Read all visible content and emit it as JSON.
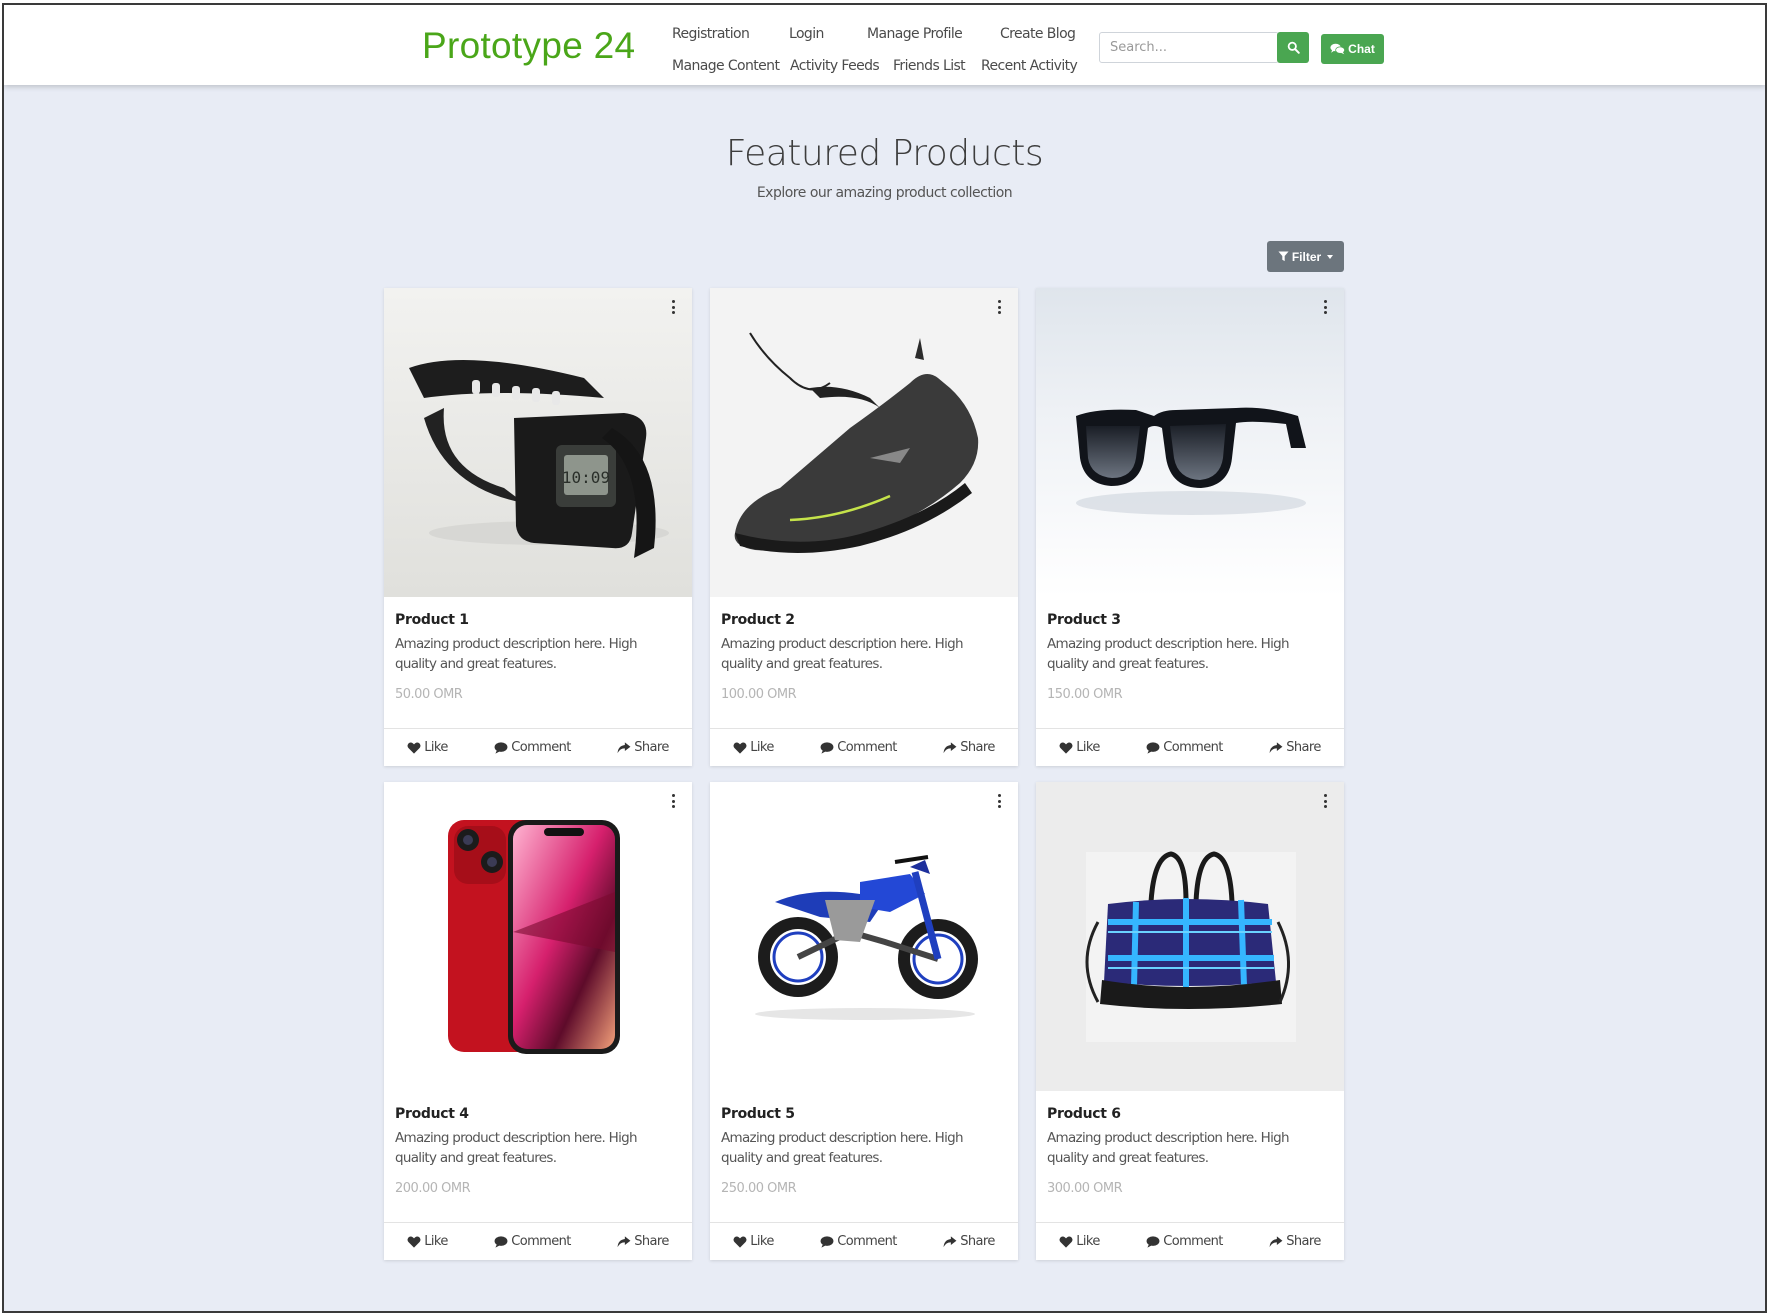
{
  "brand": "Prototype 24",
  "nav": {
    "row1": [
      "Registration",
      "Login",
      "Manage Profile",
      "Create Blog"
    ],
    "row2": [
      "Manage Content",
      "Activity Feeds",
      "Friends List",
      "Recent Activity"
    ]
  },
  "search": {
    "placeholder": "Search..."
  },
  "chat_label": "Chat",
  "heading": {
    "title": "Featured Products",
    "subtitle": "Explore our amazing product collection"
  },
  "filter_label": "Filter",
  "actions": {
    "like": "Like",
    "comment": "Comment",
    "share": "Share"
  },
  "products": [
    {
      "title": "Product 1",
      "description": "Amazing product description here. High quality and great features.",
      "price": "50.00 OMR",
      "image": "watch"
    },
    {
      "title": "Product 2",
      "description": "Amazing product description here. High quality and great features.",
      "price": "100.00 OMR",
      "image": "sneaker"
    },
    {
      "title": "Product 3",
      "description": "Amazing product description here. High quality and great features.",
      "price": "150.00 OMR",
      "image": "sunglasses"
    },
    {
      "title": "Product 4",
      "description": "Amazing product description here. High quality and great features.",
      "price": "200.00 OMR",
      "image": "phone"
    },
    {
      "title": "Product 5",
      "description": "Amazing product description here. High quality and great features.",
      "price": "250.00 OMR",
      "image": "motorbike"
    },
    {
      "title": "Product 6",
      "description": "Amazing product description here. High quality and great features.",
      "price": "300.00 OMR",
      "image": "bag"
    }
  ],
  "colors": {
    "brand": "#4aa619",
    "accent": "#4aa651",
    "filter": "#6c757d",
    "background": "#e8ecf5"
  }
}
